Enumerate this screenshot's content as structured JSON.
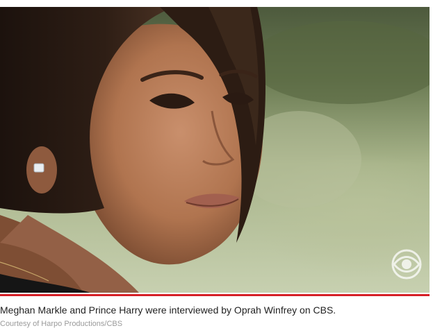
{
  "figure": {
    "caption": "Meghan Markle and Prince Harry were interviewed by Oprah Winfrey on CBS.",
    "credit": "Courtesy of Harpo Productions/CBS",
    "watermark_icon": "cbs-eye-logo-icon"
  },
  "colors": {
    "accent_rule": "#d61f26",
    "caption_text": "#222222",
    "credit_text": "#9a9a9a"
  }
}
